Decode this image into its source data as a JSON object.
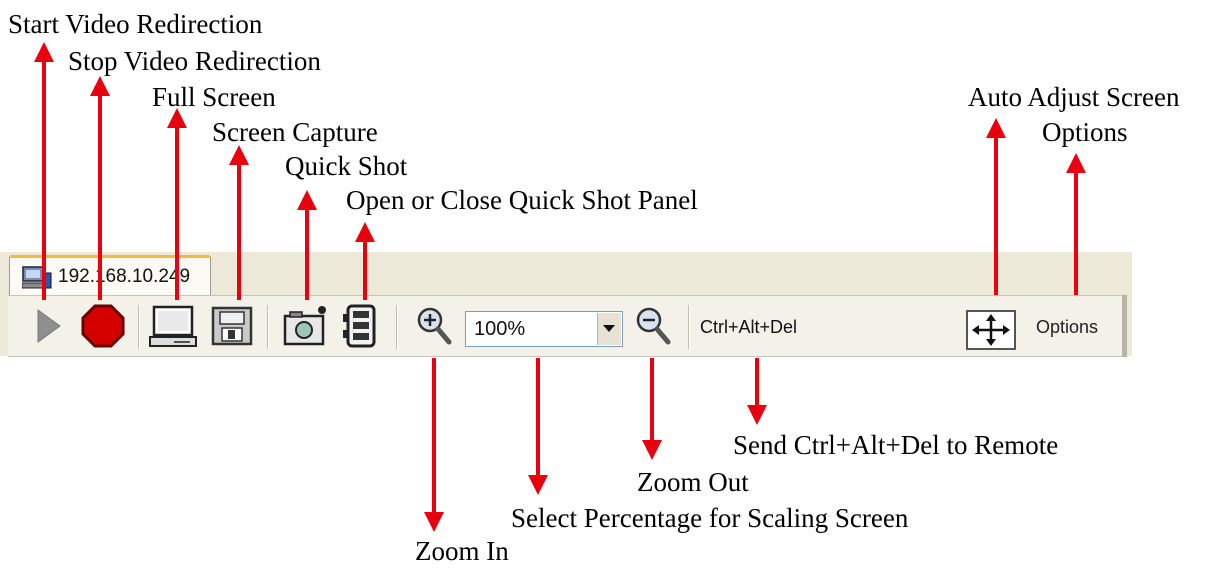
{
  "callouts": {
    "start_video": "Start Video Redirection",
    "stop_video": "Stop Video Redirection",
    "full_screen": "Full Screen",
    "screen_capture": "Screen Capture",
    "quick_shot": "Quick Shot",
    "quick_shot_panel": "Open or Close Quick Shot Panel",
    "auto_adjust": "Auto Adjust Screen",
    "options": "Options",
    "zoom_in": "Zoom In",
    "select_percentage": "Select Percentage for Scaling Screen",
    "zoom_out": "Zoom Out",
    "send_cad": "Send Ctrl+Alt+Del to Remote"
  },
  "tab": {
    "label": "192.168.10.249"
  },
  "toolbar": {
    "zoom_value": "100%",
    "ctrl_alt_del_label": "Ctrl+Alt+Del",
    "options_label": "Options"
  },
  "icons": {
    "start": "play-icon",
    "stop": "stop-icon",
    "full_screen": "monitor-icon",
    "screen_capture": "floppy-icon",
    "quick_shot": "camera-icon",
    "quick_shot_panel": "panel-icon",
    "zoom_in": "zoom-in-icon",
    "zoom_out": "zoom-out-icon",
    "dropdown": "dropdown-arrow-icon",
    "auto_adjust": "four-way-arrow-icon",
    "tab": "computer-icon"
  },
  "colors": {
    "arrow": "#e8000f",
    "stop": "#d40000",
    "tab_accent": "#f5b93d",
    "toolbar_bg": "#f3f1e8"
  }
}
